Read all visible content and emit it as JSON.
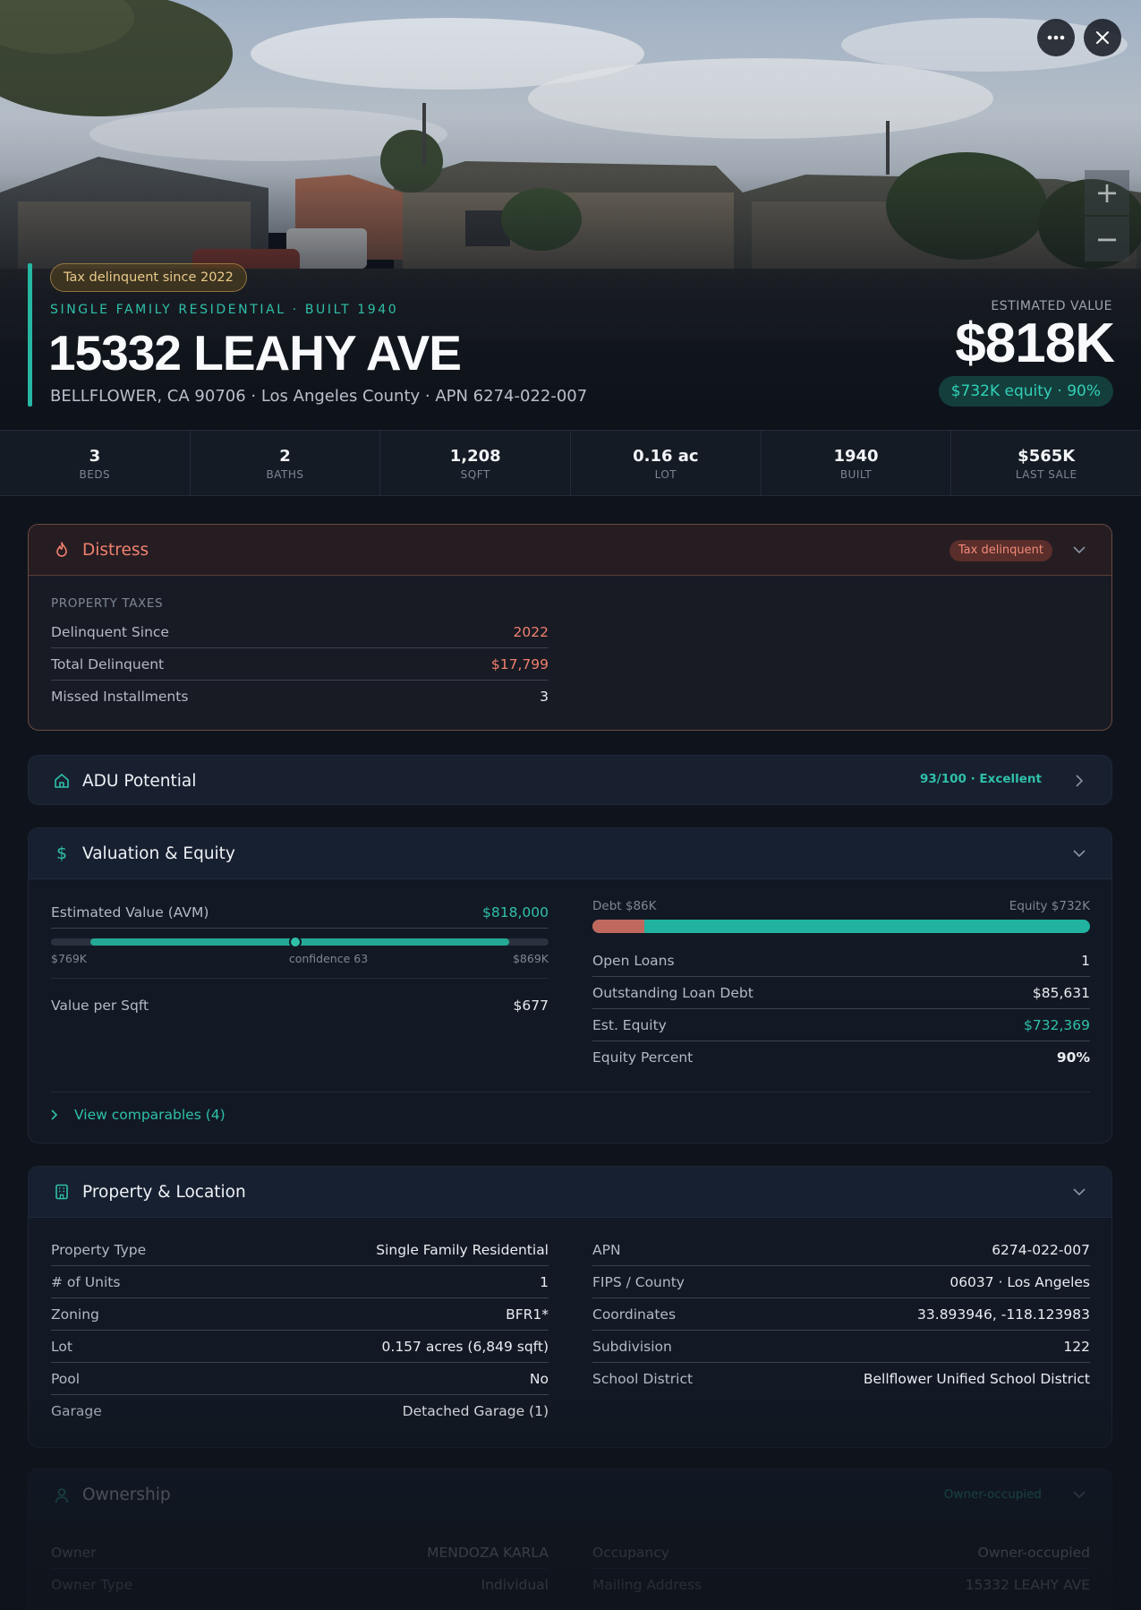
{
  "hero": {
    "tax_badge": "Tax delinquent since 2022",
    "subtype": "SINGLE FAMILY RESIDENTIAL · BUILT 1940",
    "address": "15332 LEAHY AVE",
    "city_line": "BELLFLOWER, CA 90706 · Los Angeles County · APN 6274-022-007",
    "estimated_value_label": "ESTIMATED VALUE",
    "estimated_value": "$818K",
    "equity_pill": "$732K equity · 90%",
    "icons": {
      "more": "more-icon",
      "close": "close-icon",
      "zoom_in": "plus-icon",
      "zoom_out": "minus-icon"
    }
  },
  "stats": [
    {
      "value": "3",
      "label": "BEDS"
    },
    {
      "value": "2",
      "label": "BATHS"
    },
    {
      "value": "1,208",
      "label": "SQFT"
    },
    {
      "value": "0.16 ac",
      "label": "LOT"
    },
    {
      "value": "1940",
      "label": "BUILT"
    },
    {
      "value": "$565K",
      "label": "LAST SALE"
    }
  ],
  "distress": {
    "title": "Distress",
    "badge": "Tax delinquent",
    "group_label": "PROPERTY TAXES",
    "rows": [
      {
        "key": "Delinquent Since",
        "value": "2022"
      },
      {
        "key": "Total Delinquent",
        "value": "$17,799"
      },
      {
        "key": "Missed Installments",
        "value": "3"
      }
    ],
    "accent": "#f0806e"
  },
  "adu": {
    "title": "ADU Potential",
    "score": "93/100 · Excellent"
  },
  "valuation": {
    "title": "Valuation & Equity",
    "avm_label": "Estimated Value (AVM)",
    "avm_value": "$818,000",
    "range_low": "$769K",
    "range_high": "$869K",
    "confidence": "confidence 63",
    "confidence_value": 63,
    "per_sqft_label": "Value per Sqft",
    "per_sqft_value": "$677",
    "debt_label": "Debt $86K",
    "equity_label": "Equity $732K",
    "debt_fraction": 0.105,
    "rows": [
      {
        "key": "Open Loans",
        "value": "1"
      },
      {
        "key": "Outstanding Loan Debt",
        "value": "$85,631"
      },
      {
        "key": "Est. Equity",
        "value": "$732,369"
      },
      {
        "key": "Equity Percent",
        "value": "90%"
      }
    ],
    "comparables": "View comparables (4)"
  },
  "property": {
    "title": "Property & Location",
    "left": [
      {
        "key": "Property Type",
        "value": "Single Family Residential"
      },
      {
        "key": "# of Units",
        "value": "1"
      },
      {
        "key": "Zoning",
        "value": "BFR1*"
      },
      {
        "key": "Lot",
        "value": "0.157 acres (6,849 sqft)"
      },
      {
        "key": "Pool",
        "value": "No"
      },
      {
        "key": "Garage",
        "value": "Detached Garage (1)"
      }
    ],
    "right": [
      {
        "key": "APN",
        "value": "6274-022-007"
      },
      {
        "key": "FIPS / County",
        "value": "06037 · Los Angeles"
      },
      {
        "key": "Coordinates",
        "value": "33.893946, -118.123983"
      },
      {
        "key": "Subdivision",
        "value": "122"
      },
      {
        "key": "School District",
        "value": "Bellflower Unified School District"
      }
    ]
  },
  "ownership": {
    "title": "Ownership",
    "badge": "Owner-occupied",
    "left": [
      {
        "key": "Owner",
        "value": "MENDOZA KARLA"
      },
      {
        "key": "Owner Type",
        "value": "Individual"
      }
    ],
    "right": [
      {
        "key": "Occupancy",
        "value": "Owner-occupied"
      },
      {
        "key": "Mailing Address",
        "value": "15332 LEAHY AVE"
      }
    ]
  },
  "colors": {
    "teal": "#2fc0aa",
    "red": "#f0806e",
    "gold": "#e8c98a"
  }
}
